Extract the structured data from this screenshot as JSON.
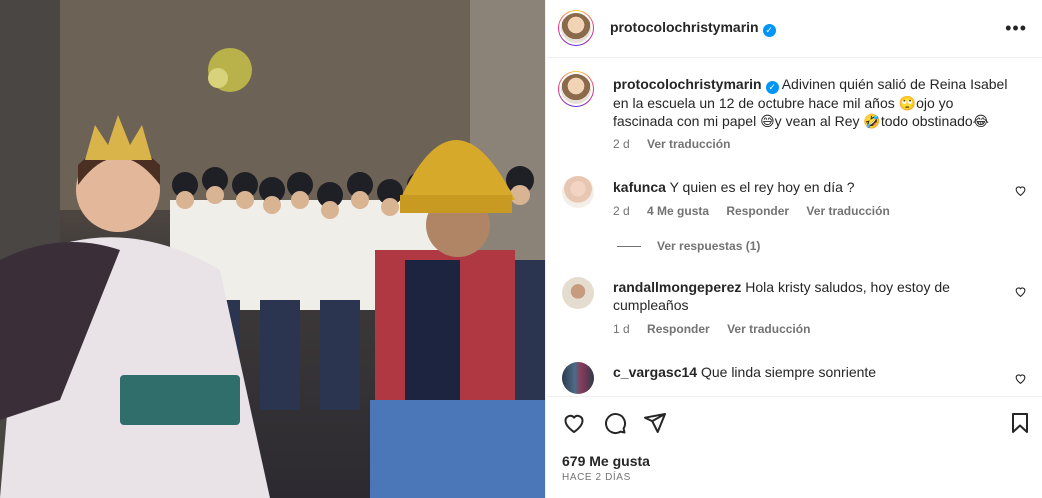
{
  "post": {
    "username": "protocolochristymarin",
    "caption": "Adivinen quién salió de Reina Isabel en la escuela un 12 de octubre hace mil años 🙄ojo yo fascinada con mi papel 😅y vean al Rey 🤣todo obstinado😂",
    "caption_age": "2 d",
    "see_translation": "Ver traducción",
    "likes": "679 Me gusta",
    "posted": "HACE 2 DÍAS"
  },
  "comments": [
    {
      "username": "kafunca",
      "text": "Y quien es el rey hoy en día ?",
      "age": "2 d",
      "likes": "4 Me gusta",
      "reply": "Responder",
      "translate": "Ver traducción",
      "view_replies": "Ver respuestas (1)"
    },
    {
      "username": "randallmongeperez",
      "text": "Hola kristy saludos, hoy estoy de cumpleaños",
      "age": "1 d",
      "reply": "Responder",
      "translate": "Ver traducción"
    },
    {
      "username": "c_vargasc14",
      "text": "Que linda siempre sonriente"
    }
  ],
  "icons": {
    "like": "heart-icon",
    "comment": "comment-icon",
    "share": "share-icon",
    "save": "bookmark-icon",
    "more": "more-options-icon",
    "verified": "verified-badge-icon"
  }
}
